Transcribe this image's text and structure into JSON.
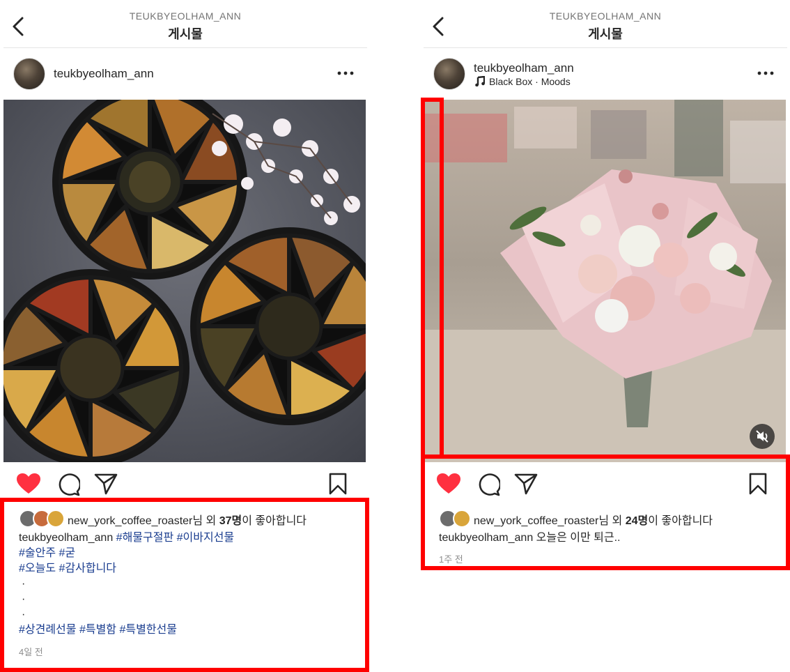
{
  "left_post": {
    "header": {
      "username": "TEUKBYEOLHAM_ANN",
      "title": "게시물"
    },
    "author": "teukbyeolham_ann",
    "likes": {
      "liker": "new_york_coffee_roaster",
      "mid": "님 외 ",
      "count": "37명",
      "suffix": "이 좋아합니다"
    },
    "caption": {
      "author": "teukbyeolham_ann",
      "tags_line1": [
        "#해물구절판",
        "#이바지선물"
      ],
      "tags_line2": [
        "#술안주",
        "#굳"
      ],
      "tags_line3": [
        "#오늘도",
        "#감사합니다"
      ],
      "dots": [
        "·",
        "·",
        "·"
      ],
      "tags_line4": [
        "#상견례선물",
        "#특별함",
        "#특별한선물"
      ]
    },
    "timestamp": "4일 전"
  },
  "right_post": {
    "header": {
      "username": "TEUKBYEOLHAM_ANN",
      "title": "게시물"
    },
    "author": "teukbyeolham_ann",
    "music": "Black Box · Moods",
    "likes": {
      "liker": "new_york_coffee_roaster",
      "mid": "님 외 ",
      "count": "24명",
      "suffix": "이 좋아합니다"
    },
    "caption": {
      "author": "teukbyeolham_ann",
      "text": "오늘은 이만 퇴근.."
    },
    "timestamp": "1주 전"
  },
  "icons": {
    "back": "chevron-left-icon",
    "more": "more-horizontal-icon",
    "like": "heart-filled-icon",
    "comment": "comment-icon",
    "share": "send-icon",
    "save": "bookmark-icon",
    "music": "music-note-icon",
    "mute": "muted-speaker-icon"
  },
  "colors": {
    "like_red": "#ff3040",
    "highlight_red": "#ff0000",
    "hashtag": "#1a3d8f",
    "timestamp": "#8e8e8e"
  }
}
